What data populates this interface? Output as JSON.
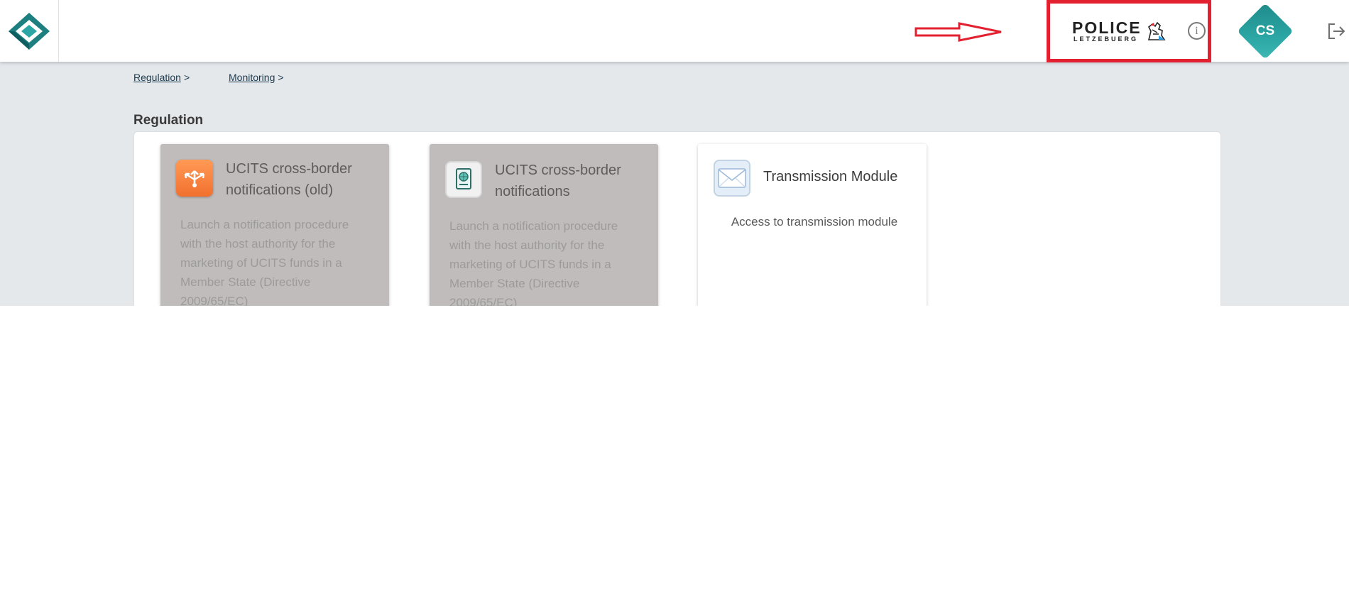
{
  "header": {
    "logo_icon": "brand-diamond-logo",
    "annotation_arrow_color": "#e3202f",
    "police_logo": {
      "word": "POLICE",
      "subword": "LETZEBUERG",
      "emblem_icon": "lion-crest-icon"
    },
    "info_icon_glyph": "i",
    "avatar": {
      "initials": "CS",
      "color": "#2ba6a4"
    },
    "logout_icon": "logout-icon"
  },
  "breadcrumb": [
    {
      "label": "Regulation",
      "separator": ">"
    },
    {
      "label": "Monitoring",
      "separator": ">"
    }
  ],
  "section": {
    "title": "Regulation"
  },
  "cards": [
    {
      "title": "UCITS cross-border notifications (old)",
      "description": "Launch a notification procedure with the host authority for the marketing of UCITS funds in a Member State (Directive 2009/65/EC)",
      "icon": "distribution-icon",
      "state": "disabled"
    },
    {
      "title": "UCITS cross-border notifications",
      "description": "Launch a notification procedure with the host authority for the marketing of UCITS funds in a Member State (Directive 2009/65/EC)",
      "icon": "passport-icon",
      "state": "disabled"
    },
    {
      "title": "Transmission Module",
      "description": "Access to transmission module",
      "icon": "envelope-icon",
      "state": "enabled"
    }
  ]
}
